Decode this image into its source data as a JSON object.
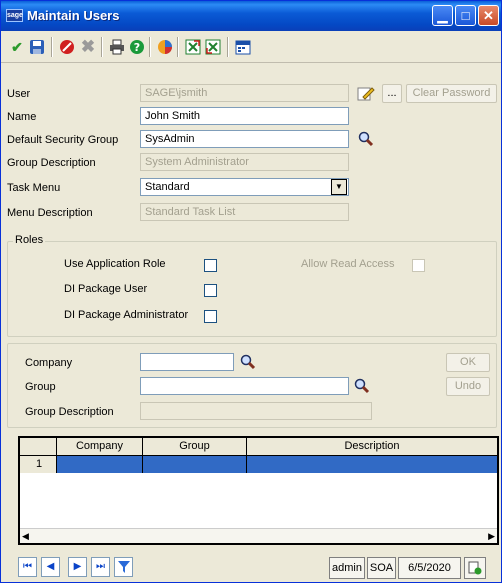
{
  "window": {
    "app_icon": "sage",
    "title": "Maintain Users"
  },
  "toolbar": {
    "icons": [
      "checkmark-icon",
      "save-icon",
      "cancel-icon",
      "delete-icon",
      "print-icon",
      "help-icon",
      "chart-icon",
      "export-icon",
      "import-icon",
      "calendar-icon"
    ]
  },
  "form": {
    "user_label": "User",
    "user_value": "SAGE\\jsmith",
    "clear_password_label": "Clear Password",
    "ellipsis_label": "...",
    "name_label": "Name",
    "name_value": "John Smith",
    "default_security_group_label": "Default Security Group",
    "default_security_group_value": "SysAdmin",
    "group_description_label": "Group Description",
    "group_description_value": "System Administrator",
    "task_menu_label": "Task Menu",
    "task_menu_value": "Standard",
    "menu_description_label": "Menu Description",
    "menu_description_value": "Standard Task List"
  },
  "roles": {
    "legend": "Roles",
    "use_application_role_label": "Use Application Role",
    "allow_read_access_label": "Allow Read Access",
    "di_package_user_label": "DI Package User",
    "di_package_administrator_label": "DI Package Administrator"
  },
  "company_section": {
    "company_label": "Company",
    "company_value": "",
    "group_label": "Group",
    "group_value": "",
    "group_description_label": "Group Description",
    "group_description_value": "",
    "ok_label": "OK",
    "undo_label": "Undo"
  },
  "grid": {
    "columns": [
      "Company",
      "Group",
      "Description"
    ],
    "rows": [
      {
        "num": "1",
        "company": "",
        "group": "",
        "description": ""
      }
    ]
  },
  "statusbar": {
    "user": "admin",
    "company": "SOA",
    "date": "6/5/2020"
  },
  "colors": {
    "title_bar": "#0a5fd8",
    "selected_row": "#316ac5",
    "window_bg": "#ece9d8"
  }
}
